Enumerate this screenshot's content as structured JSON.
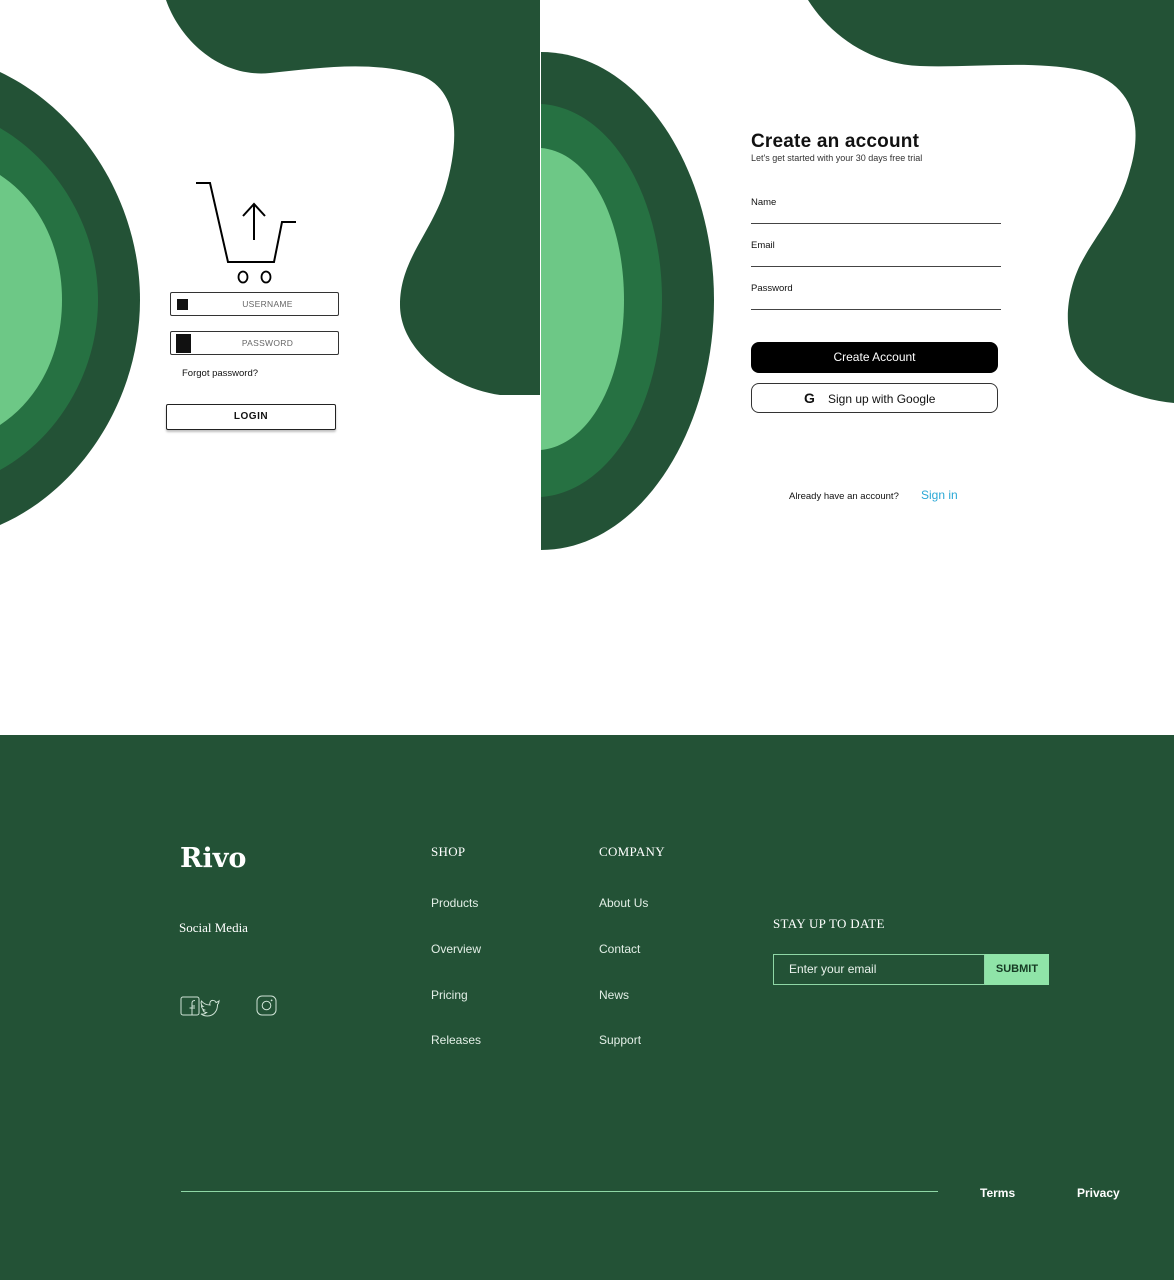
{
  "colors": {
    "dark_green": "#235236",
    "mid_green": "#267142",
    "light_green": "#6dc886",
    "accent_blue": "#2aa8d6",
    "submit_bg": "#8fe4a8"
  },
  "login": {
    "icon": "cart-upload-icon",
    "username_placeholder": "USERNAME",
    "password_placeholder": "PASSWORD",
    "forgot_password": "Forgot password?",
    "login_button": "LOGIN"
  },
  "signup": {
    "title": "Create an account",
    "subtitle": "Let's get started with your 30 days free trial",
    "fields": {
      "name": "Name",
      "email": "Email",
      "password": "Password"
    },
    "create_button": "Create Account",
    "google_button": "Sign up with Google",
    "google_icon": "G",
    "already_text": "Already have an account?",
    "sign_in_link": "Sign in"
  },
  "footer": {
    "brand": "Rivo",
    "social_title": "Social Media",
    "social_icons": [
      "facebook-icon",
      "twitter-icon",
      "instagram-icon"
    ],
    "shop": {
      "heading": "SHOP",
      "links": [
        "Products",
        "Overview",
        "Pricing",
        "Releases"
      ]
    },
    "company": {
      "heading": "COMPANY",
      "links": [
        "About Us",
        "Contact",
        "News",
        "Support"
      ]
    },
    "newsletter": {
      "heading": "STAY UP TO DATE",
      "placeholder": "Enter your email",
      "submit": "SUBMIT"
    },
    "legal": {
      "terms": "Terms",
      "privacy": "Privacy"
    }
  }
}
